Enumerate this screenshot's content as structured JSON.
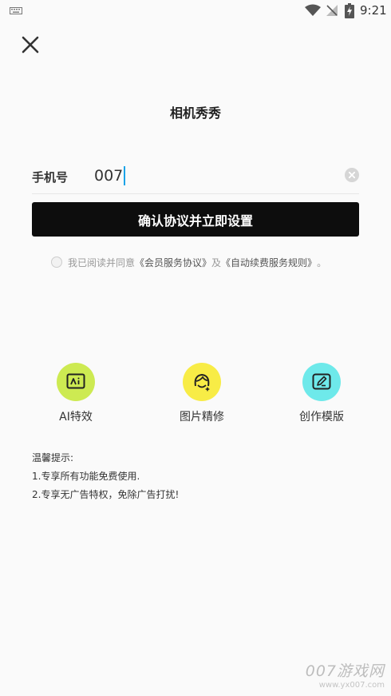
{
  "status_bar": {
    "time": "9:21",
    "icons": [
      "keyboard-icon",
      "wifi-icon",
      "no-signal-icon",
      "battery-charging-icon"
    ]
  },
  "header": {
    "close_icon": "close-icon",
    "title": "相机秀秀"
  },
  "form": {
    "phone_label": "手机号",
    "phone_value": "007",
    "clear_icon": "clear-icon",
    "confirm_button": "确认协议并立即设置",
    "agreement": {
      "checked": false,
      "prefix": "我已阅读并同意",
      "link1": "《会员服务协议》",
      "middle": "及",
      "link2": "《自动续费服务规则》",
      "suffix": "。"
    }
  },
  "features": [
    {
      "label": "AI特效",
      "icon": "ai-image-icon",
      "color": "#cdea52"
    },
    {
      "label": "图片精修",
      "icon": "face-retouch-icon",
      "color": "#f8ec46"
    },
    {
      "label": "创作模版",
      "icon": "edit-template-icon",
      "color": "#6ee9ea"
    }
  ],
  "tips": {
    "heading": "温馨提示:",
    "items": [
      "1.专享所有功能免费使用.",
      "2.专享无广告特权，免除广告打扰!"
    ]
  },
  "watermark": {
    "main": "007游戏网",
    "sub": "www.yx007.com"
  },
  "colors": {
    "button_bg": "#0d0d0d",
    "caret": "#1aa3e8",
    "background": "#fafafa"
  }
}
